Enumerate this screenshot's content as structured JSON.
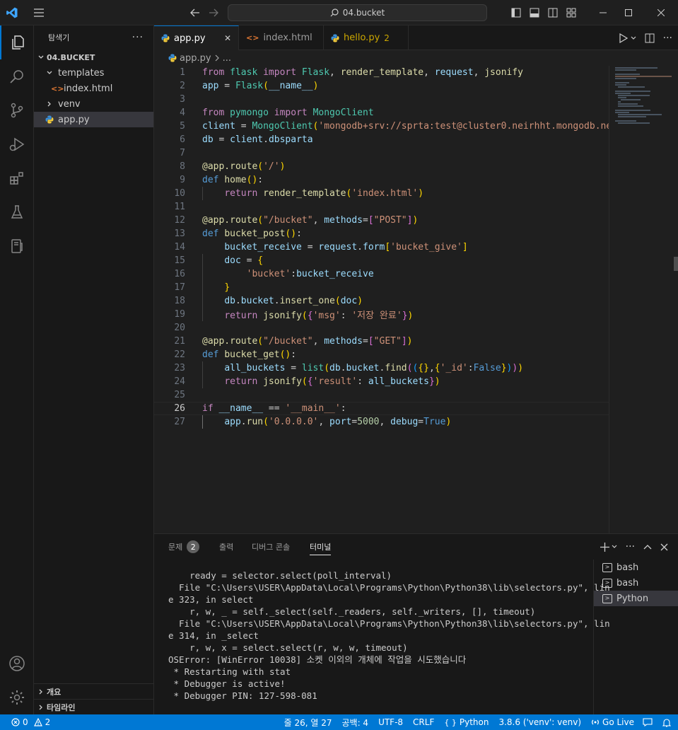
{
  "titlebar": {
    "search_text": "04.bucket"
  },
  "sidebar": {
    "title": "탐색기",
    "more": "···",
    "root": "04.BUCKET",
    "tree": [
      {
        "label": "templates",
        "kind": "folder-open"
      },
      {
        "label": "index.html",
        "kind": "html"
      },
      {
        "label": "venv",
        "kind": "folder-closed"
      },
      {
        "label": "app.py",
        "kind": "python"
      }
    ],
    "outline": "개요",
    "timeline": "타임라인"
  },
  "tabs": [
    {
      "label": "app.py",
      "icon": "python-icon",
      "close": "✕"
    },
    {
      "label": "index.html",
      "icon": "html-icon"
    },
    {
      "label": "hello.py",
      "icon": "python-icon",
      "badge": "2"
    }
  ],
  "breadcrumb": {
    "file": "app.py",
    "rest": "..."
  },
  "editor": {
    "line_numbers": [
      "1",
      "2",
      "3",
      "4",
      "5",
      "6",
      "7",
      "8",
      "9",
      "10",
      "11",
      "12",
      "13",
      "14",
      "15",
      "16",
      "17",
      "18",
      "19",
      "20",
      "21",
      "22",
      "23",
      "24",
      "25",
      "26",
      "27"
    ],
    "current_line": 26,
    "accent": "#0078d4"
  },
  "panel": {
    "tabs": [
      {
        "label": "문제",
        "badge": "2"
      },
      {
        "label": "출력"
      },
      {
        "label": "디버그 콘솔"
      },
      {
        "label": "터미널"
      }
    ],
    "terminal_lines": [
      "    ready = selector.select(poll_interval)",
      "  File \"C:\\Users\\USER\\AppData\\Local\\Programs\\Python\\Python38\\lib\\selectors.py\", lin",
      "e 323, in select",
      "    r, w, _ = self._select(self._readers, self._writers, [], timeout)",
      "  File \"C:\\Users\\USER\\AppData\\Local\\Programs\\Python\\Python38\\lib\\selectors.py\", lin",
      "e 314, in _select",
      "    r, w, x = select.select(r, w, w, timeout)",
      "OSError: [WinError 10038] 소켓 이외의 개체에 작업을 시도했습니다",
      " * Restarting with stat",
      " * Debugger is active!",
      " * Debugger PIN: 127-598-081"
    ],
    "terminals": [
      "bash",
      "bash",
      "Python"
    ]
  },
  "statusbar": {
    "errors": "0",
    "warnings": "2",
    "position": "줄 26, 열 27",
    "indent": "공백: 4",
    "encoding": "UTF-8",
    "eol": "CRLF",
    "language": "Python",
    "interpreter": "3.8.6 ('venv': venv)",
    "golive": "Go Live",
    "color": "#0078d4"
  }
}
